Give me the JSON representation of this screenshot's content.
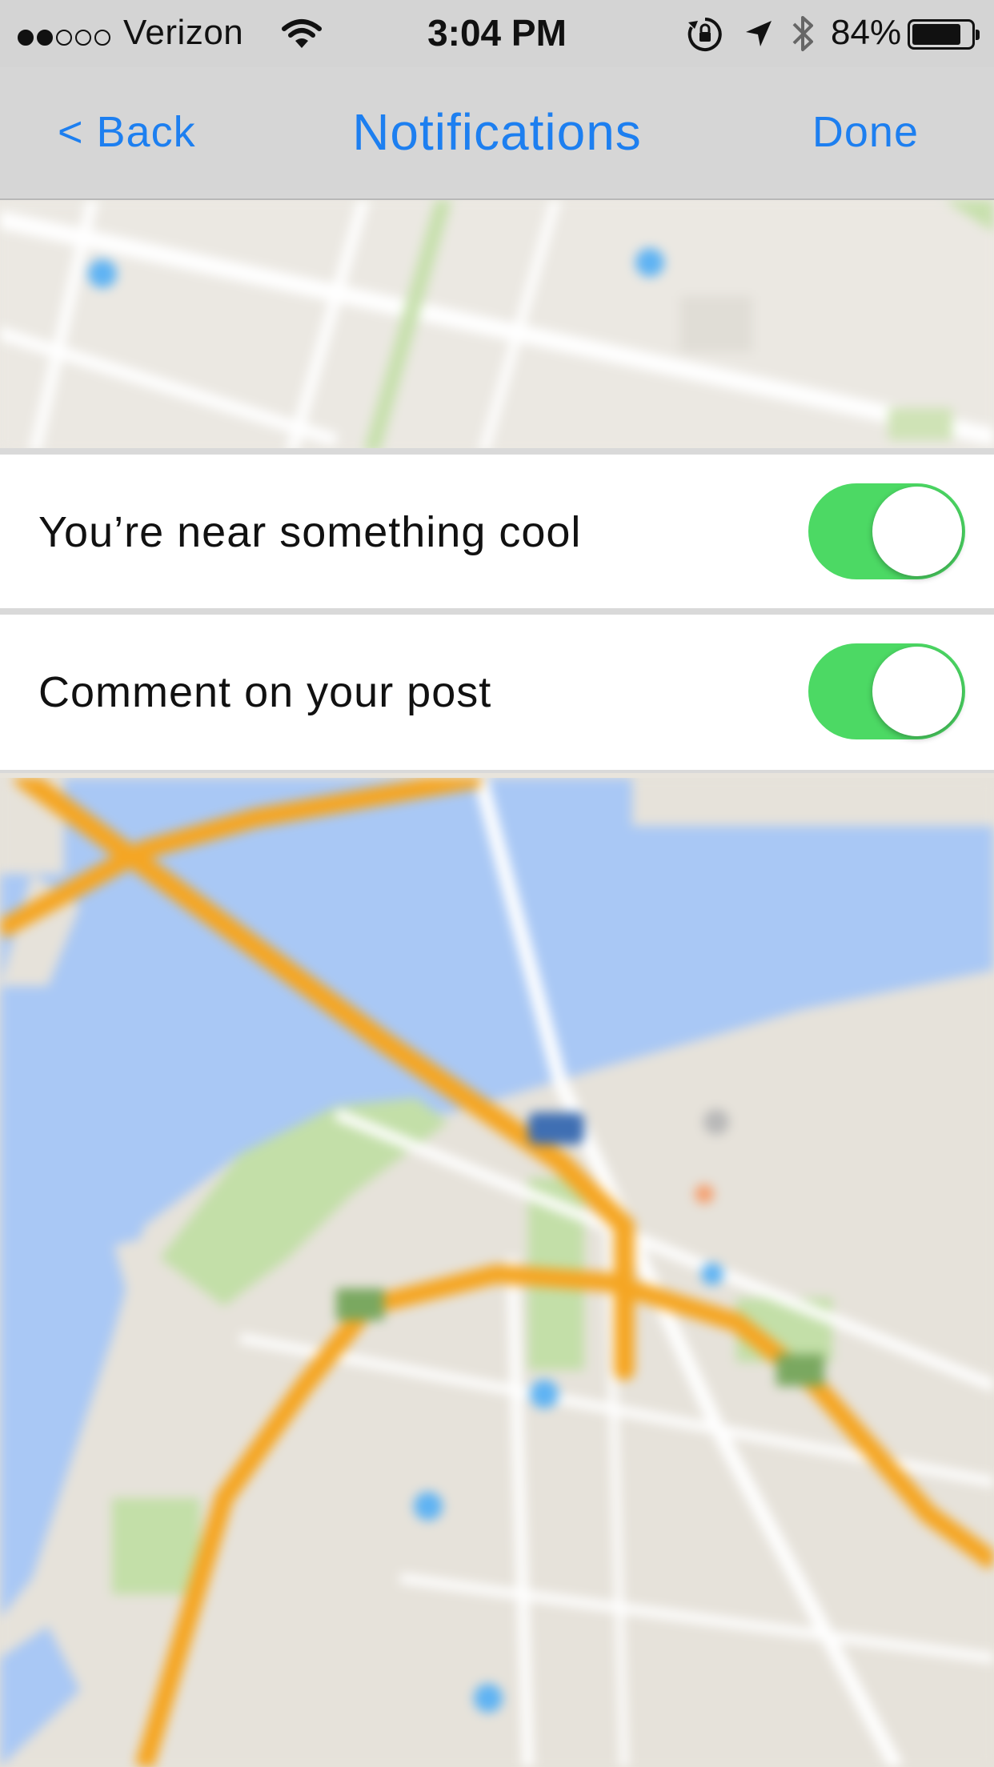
{
  "status_bar": {
    "carrier": "Verizon",
    "signal_bars_filled": 2,
    "signal_bars_total": 5,
    "time": "3:04 PM",
    "battery_percent_label": "84%",
    "battery_level": 0.84
  },
  "nav": {
    "back_label": "< Back",
    "title": "Notifications",
    "done_label": "Done"
  },
  "settings": [
    {
      "label": "You’re near something cool",
      "enabled": true
    },
    {
      "label": "Comment on your post",
      "enabled": true
    }
  ],
  "colors": {
    "accent": "#1d7ff0",
    "toggle_on": "#4cd964",
    "water": "#a9c8f5",
    "highway": "#f5a623",
    "park": "#c3dfa8",
    "land": "#e6e2da"
  }
}
